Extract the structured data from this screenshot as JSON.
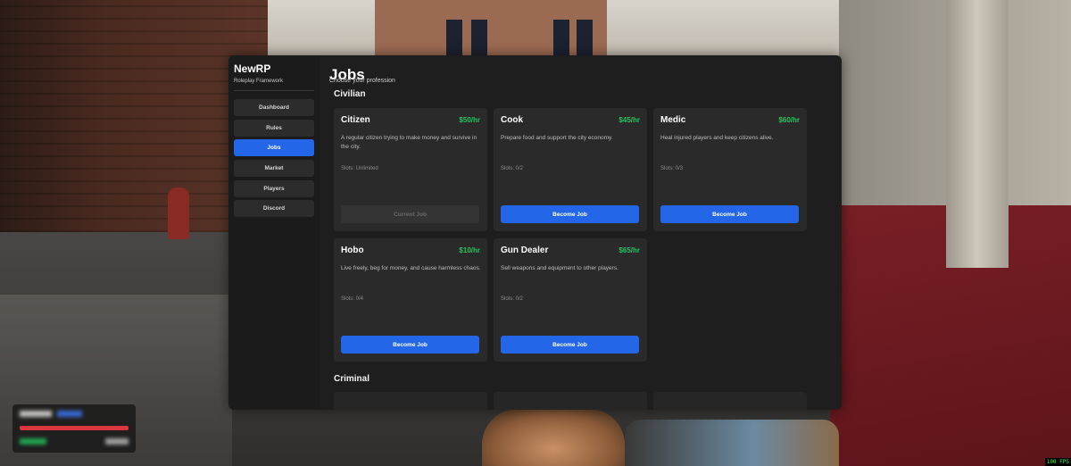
{
  "app": {
    "brand": "NewRP",
    "subtitle": "Roleplay Framework"
  },
  "sidebar": {
    "items": [
      {
        "label": "Dashboard",
        "active": false
      },
      {
        "label": "Rules",
        "active": false
      },
      {
        "label": "Jobs",
        "active": true
      },
      {
        "label": "Market",
        "active": false
      },
      {
        "label": "Players",
        "active": false
      },
      {
        "label": "Discord",
        "active": false
      }
    ]
  },
  "page": {
    "title": "Jobs",
    "subtitle": "Choose your profession"
  },
  "sections": {
    "civilian": "Civilian",
    "criminal": "Criminal"
  },
  "jobs": [
    {
      "name": "Citizen",
      "pay": "$50/hr",
      "description": "A regular citizen trying to make money and survive in the city.",
      "slots": "Slots: Unlimited",
      "button": "Current Job",
      "current": true
    },
    {
      "name": "Cook",
      "pay": "$45/hr",
      "description": "Prepare food and support the city economy.",
      "slots": "Slots: 0/2",
      "button": "Become Job",
      "current": false
    },
    {
      "name": "Medic",
      "pay": "$60/hr",
      "description": "Heal injured players and keep citizens alive.",
      "slots": "Slots: 0/3",
      "button": "Become Job",
      "current": false
    },
    {
      "name": "Hobo",
      "pay": "$10/hr",
      "description": "Live freely, beg for money, and cause harmless chaos.",
      "slots": "Slots: 0/4",
      "button": "Become Job",
      "current": false
    },
    {
      "name": "Gun Dealer",
      "pay": "$65/hr",
      "description": "Sell weapons and equipment to other players.",
      "slots": "Slots: 0/2",
      "button": "Become Job",
      "current": false
    }
  ],
  "overlay": {
    "fps": "100 FPS"
  },
  "colors": {
    "accent": "#2466e8",
    "pay": "#22c55e",
    "panel": "#1e1e1e",
    "card": "#2a2a2a"
  }
}
